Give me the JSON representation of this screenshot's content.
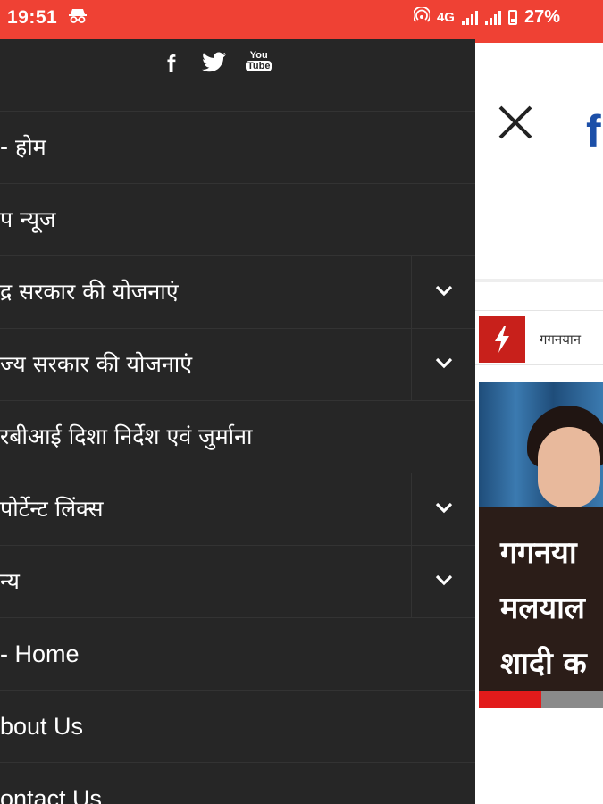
{
  "status_bar": {
    "time": "19:51",
    "network": "4G",
    "battery": "27%",
    "bg_color": "#ef4134"
  },
  "drawer": {
    "bg_color": "#262626",
    "social": [
      "facebook-icon",
      "twitter-icon",
      "youtube-icon"
    ],
    "youtube_you": "You",
    "youtube_tube": "Tube",
    "items": [
      {
        "label": "- होम",
        "expandable": false
      },
      {
        "label": "प न्यूज",
        "expandable": false
      },
      {
        "label": "द्र सरकार की योजनाएं",
        "expandable": true
      },
      {
        "label": "ज्य सरकार की योजनाएं",
        "expandable": true
      },
      {
        "label": "रबीआई दिशा निर्देश एवं जुर्माना",
        "expandable": false
      },
      {
        "label": "पोर्टेन्ट लिंक्स",
        "expandable": true
      },
      {
        "label": "न्य",
        "expandable": true
      },
      {
        "label": "- Home",
        "expandable": false
      },
      {
        "label": "bout Us",
        "expandable": false
      },
      {
        "label": "ontact Us",
        "expandable": false
      }
    ]
  },
  "content": {
    "brand_letter": "f",
    "ticker_text": "गगनयान",
    "headline_lines": [
      "गगनया",
      "मलयाल",
      "शादी क"
    ],
    "progress_fraction": 0.5,
    "accent": "#e21b1b"
  }
}
